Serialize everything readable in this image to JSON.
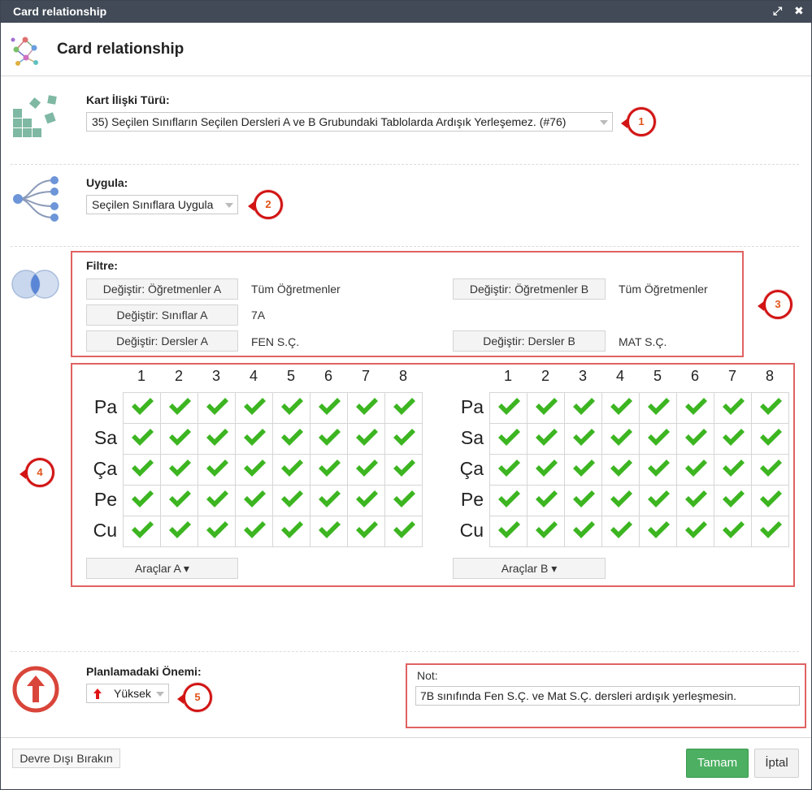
{
  "window": {
    "title": "Card relationship"
  },
  "header": {
    "title": "Card relationship"
  },
  "relation_type": {
    "label": "Kart İlişki Türü:",
    "value": "35) Seçilen Sınıfların Seçilen Dersleri A ve B Grubundaki Tablolarda Ardışık Yerleşemez. (#76)",
    "badge": "1"
  },
  "apply": {
    "label": "Uygula:",
    "value": "Seçilen Sınıflara Uygula",
    "badge": "2"
  },
  "filter": {
    "label": "Filtre:",
    "badge": "3",
    "teachers_a_button": "Değiştir: Öğretmenler A",
    "teachers_a_value": "Tüm Öğretmenler",
    "teachers_b_button": "Değiştir: Öğretmenler B",
    "teachers_b_value": "Tüm Öğretmenler",
    "classes_a_button": "Değiştir: Sınıflar A",
    "classes_a_value": "7A",
    "subjects_a_button": "Değiştir: Dersler A",
    "subjects_a_value": "FEN S.Ç.",
    "subjects_b_button": "Değiştir: Dersler B",
    "subjects_b_value": "MAT S.Ç."
  },
  "timetable": {
    "badge": "4",
    "periods": [
      "1",
      "2",
      "3",
      "4",
      "5",
      "6",
      "7",
      "8"
    ],
    "days": [
      "Pa",
      "Sa",
      "Ça",
      "Pe",
      "Cu"
    ],
    "tools_a": "Araçlar A ▾",
    "tools_b": "Araçlar B ▾"
  },
  "importance": {
    "label": "Planlamadaki Önemi:",
    "value": "Yüksek",
    "badge": "5"
  },
  "note": {
    "label": "Not:",
    "value": "7B sınıfında Fen S.Ç. ve Mat S.Ç. dersleri ardışık yerleşmesin."
  },
  "footer": {
    "disable_button": "Devre Dışı Bırakın",
    "ok_button": "Tamam",
    "cancel_button": "İptal"
  },
  "colors": {
    "titlebar": "#414a56",
    "badge_ring": "#d21414",
    "badge_text": "#e0541a",
    "highlight_box": "#e06262",
    "check": "#3cb521",
    "ok_button": "#4caf62"
  },
  "icons": {
    "header": "network-graph-icon",
    "relation_type": "blocks-icon",
    "apply": "tree-branch-icon",
    "filter": "venn-diagram-icon",
    "importance": "arrow-up-circle-icon",
    "cell": "check-icon",
    "expand": "expand-icon",
    "close": "close-icon"
  }
}
